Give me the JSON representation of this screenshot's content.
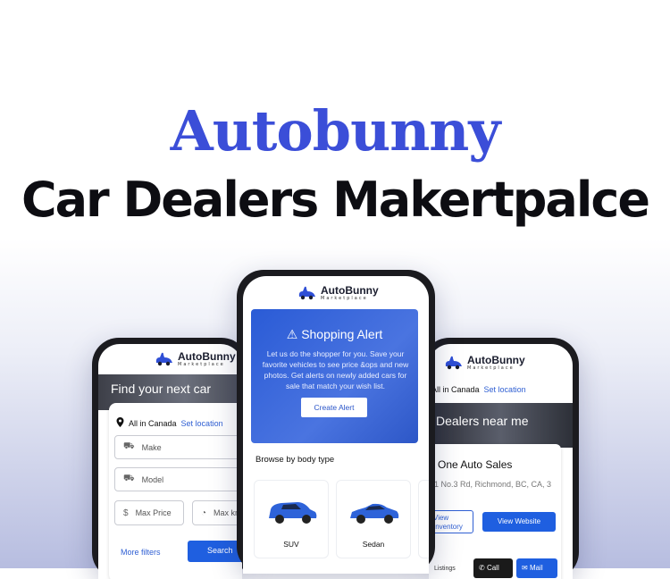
{
  "brand": "Autobunny",
  "headline": "Car Dealers Makertpalce",
  "logo": {
    "name": "AutoBunny",
    "sub": "Marketplace"
  },
  "left_phone": {
    "hero_title": "Find your next car",
    "location": "All in Canada",
    "set_location": "Set location",
    "make_placeholder": "Make",
    "model_placeholder": "Model",
    "max_price": "Max Price",
    "max_km": "Max km",
    "more_filters": "More filters",
    "search": "Search"
  },
  "center_phone": {
    "alert_title": "Shopping Alert",
    "alert_text": "Let us do the shopper for you. Save your favorite vehicles to see price &ops and new photos. Get alerts on newly added cars for sale that match your wish list.",
    "alert_button": "Create Alert",
    "browse_label": "Browse by body type",
    "body_types": [
      "SUV",
      "Sedan"
    ]
  },
  "right_phone": {
    "location": "All in Canada",
    "set_location": "Set location",
    "hero_title": "Dealers near me",
    "dealer_name": "One Auto Sales",
    "dealer_address": "1 No.3 Rd, Richmond, BC, CA, 3",
    "view_inventory": "View Inventory",
    "view_website": "View Website",
    "listings": "Listings",
    "call": "Call",
    "mail": "Mail"
  },
  "colors": {
    "brand": "#3b4ed8",
    "primary_button": "#1f5fe0",
    "link": "#2f5fd3"
  }
}
